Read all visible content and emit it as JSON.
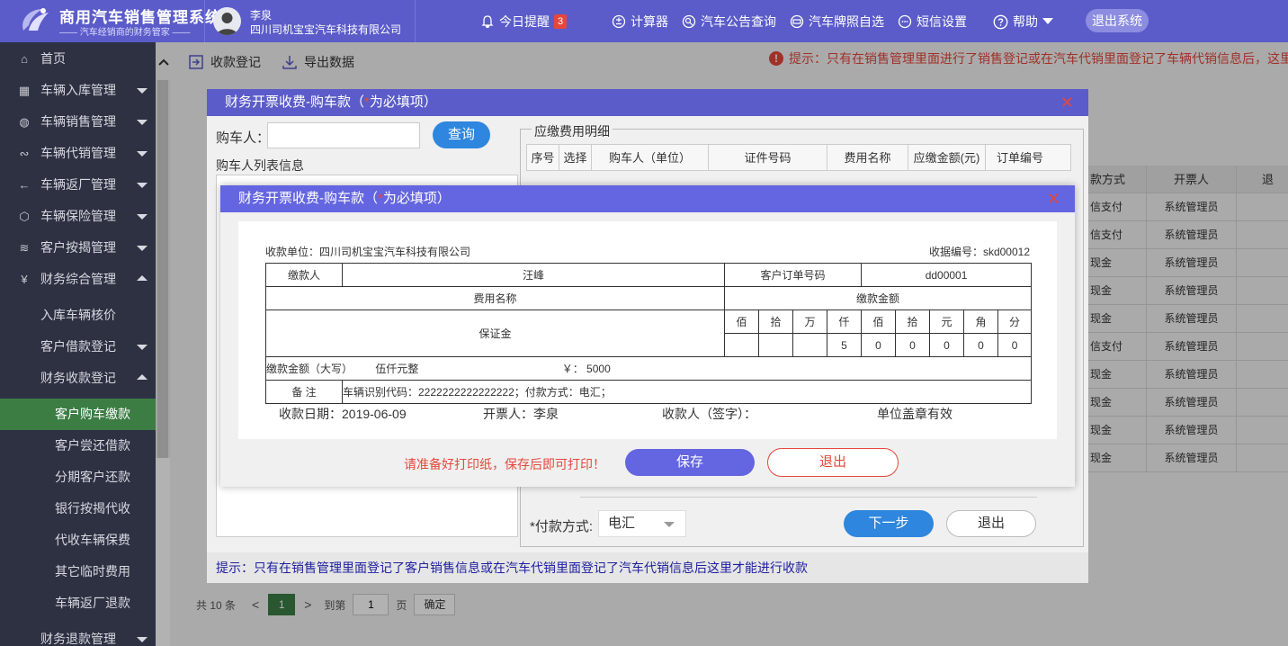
{
  "header": {
    "logo_title": "商用汽车销售管理系统",
    "logo_subtitle": "—— 汽车经销商的财务管家 ——",
    "user_name": "李泉",
    "user_company": "四川司机宝宝汽车科技有限公司",
    "reminder_label": "今日提醒",
    "reminder_count": "3",
    "calculator_label": "计算器",
    "notice_query_label": "汽车公告查询",
    "plate_label": "汽车牌照自选",
    "sms_label": "短信设置",
    "help_label": "帮助",
    "logout_label": "退出系统"
  },
  "sidebar": {
    "items": [
      {
        "label": "首页",
        "icon": "home-icon"
      },
      {
        "label": "车辆入库管理",
        "icon": "grid-icon"
      },
      {
        "label": "车辆销售管理",
        "icon": "globe-icon"
      },
      {
        "label": "车辆代销管理",
        "icon": "share-icon"
      },
      {
        "label": "车辆返厂管理",
        "icon": "back-arrow-icon"
      },
      {
        "label": "车辆保险管理",
        "icon": "shield-icon"
      },
      {
        "label": "客户按揭管理",
        "icon": "layers-icon"
      },
      {
        "label": "财务综合管理",
        "icon": "yen-icon"
      }
    ],
    "finance_sub": [
      "入库车辆核价",
      "客户借款登记",
      "财务收款登记"
    ],
    "receipt_sub": [
      "客户购车缴款",
      "客户尝还借款",
      "分期客户还款",
      "银行按揭代收",
      "代收车辆保费",
      "其它临时费用",
      "车辆返厂退款"
    ],
    "last_item": "财务退款管理"
  },
  "toolbar": {
    "receipt_label": "收款登记",
    "export_label": "导出数据",
    "tip": "提示：只有在销售管理里面进行了销售登记或在汽车代销里面登记了车辆代销信息后，这里才能收取客户的车款"
  },
  "bg_table": {
    "headers": [
      "款方式",
      "开票人",
      "退"
    ],
    "rows": [
      [
        "信支付",
        "系统管理员"
      ],
      [
        "信支付",
        "系统管理员"
      ],
      [
        "现金",
        "系统管理员"
      ],
      [
        "现金",
        "系统管理员"
      ],
      [
        "现金",
        "系统管理员"
      ],
      [
        "信支付",
        "系统管理员"
      ],
      [
        "现金",
        "系统管理员"
      ],
      [
        "现金",
        "系统管理员"
      ],
      [
        "现金",
        "系统管理员"
      ],
      [
        "现金",
        "系统管理员"
      ]
    ]
  },
  "pager": {
    "total": "共 10 条",
    "current": "1",
    "goto_label": "到第",
    "goto_value": "1",
    "page_label": "页",
    "confirm": "确定"
  },
  "dialog1": {
    "title_pre": "财务开票收费-购车款（",
    "title_star": "*",
    "title_post": "为必填项）",
    "buyer_label": "购车人：",
    "query_button": "查询",
    "buyer_list_title": "购车人列表信息",
    "fee_detail_title": "应缴费用明细",
    "columns": [
      "序号",
      "选择",
      "购车人（单位）",
      "证件号码",
      "费用名称",
      "应缴金额(元)",
      "订单编号"
    ],
    "pay_method_label": "*付款方式:",
    "pay_method_value": "电汇",
    "next_button": "下一步",
    "exit_button": "退出",
    "tip": "提示：只有在销售管理里面登记了客户销售信息或在汽车代销里面登记了汽车代销信息后这里才能进行收款"
  },
  "dialog2": {
    "title_pre": "财务开票收费-购车款（",
    "title_star": "*",
    "title_post": "为必填项）",
    "unit_label": "收款单位：四川司机宝宝汽车科技有限公司",
    "receipt_no": "收据编号：skd00012",
    "payer_label": "缴款人",
    "payer_value": "汪峰",
    "order_label": "客户订单号码",
    "order_value": "dd00001",
    "fee_name_label": "费用名称",
    "amount_label": "缴款金额",
    "fee_name_value": "保证金",
    "digit_units": [
      "佰",
      "拾",
      "万",
      "仟",
      "佰",
      "拾",
      "元",
      "角",
      "分"
    ],
    "digit_values": [
      "",
      "",
      "",
      "5",
      "0",
      "0",
      "0",
      "0",
      "0"
    ],
    "amount_caps_label": "缴款金额（大写）",
    "amount_caps_value": "伍仟元整",
    "amount_num": "￥： 5000",
    "remark_label": "备 注",
    "remark_value": "车辆识别代码：2222222222222222；付款方式：电汇；",
    "date_label": "收款日期：2019-06-09",
    "issuer_label": "开票人：李泉",
    "receiver_label": "收款人（签字）：",
    "seal_label": "单位盖章有效",
    "warn": "请准备好打印纸，保存后即可打印！",
    "save_button": "保存",
    "exit_button": "退出"
  },
  "colors": {
    "header_bg": "#5b5cc9",
    "sidebar_bg": "#2d3142",
    "active_bg": "#3c7d44",
    "danger": "#e5473c",
    "primary_blue": "#2e86de"
  }
}
